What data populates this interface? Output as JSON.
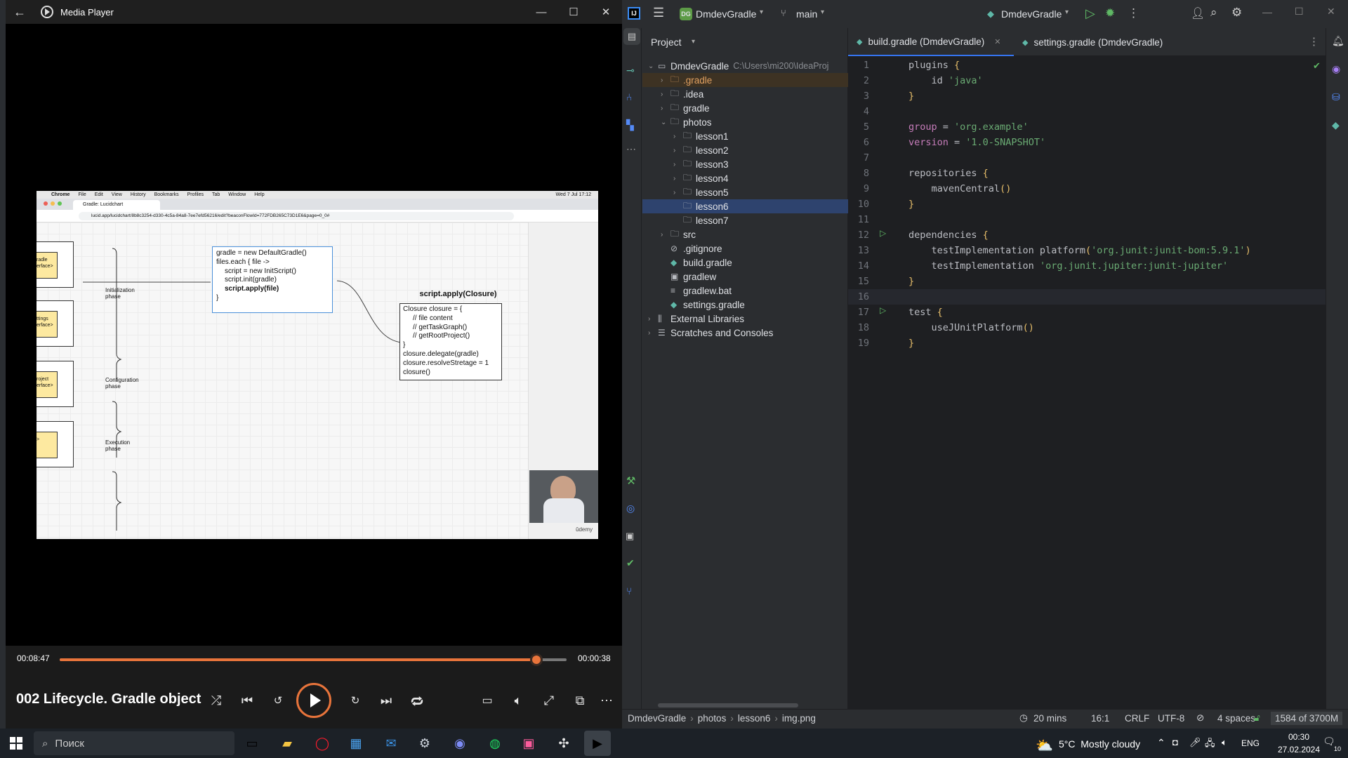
{
  "media_player": {
    "title": "Media Player",
    "video_title": "002 Lifecycle. Gradle object",
    "time_elapsed": "00:08:47",
    "time_remaining": "00:00:38",
    "progress": 0.94,
    "accent_color": "#e8743b",
    "video": {
      "browser_menu": [
        "Chrome",
        "File",
        "Edit",
        "View",
        "History",
        "Bookmarks",
        "Profiles",
        "Tab",
        "Window",
        "Help"
      ],
      "clock": "Wed 7 Jul 17:12",
      "tab_title": "Gradle: Lucidchart",
      "url": "lucid.app/lucidchart/8b8c3254-d330-4c5a-84a8-7ee7efd56216/edit?beaconFlowId=772FDB265C73D1E6&page=0_0#",
      "left_boxes": [
        "radle\nerface>",
        "ttings\nerface>",
        "roject\nerface>",
        ">"
      ],
      "phases": [
        "Initialization\nphase",
        "Configuration\nphase",
        "Execution\nphase"
      ],
      "code_box": [
        "gradle = new DefaultGradle()",
        "files.each { file ->",
        "script = new InitScript()",
        "script.init(gradle)",
        "script.apply(file)",
        "}"
      ],
      "closure_title": "script.apply(Closure)",
      "closure_box": [
        "Closure closure = {",
        "// file content",
        "// getTaskGraph()",
        "// getRootProject()",
        "}",
        "closure.delegate(gradle)",
        "closure.resolveStretage = 1",
        "closure()"
      ],
      "watermark": "ûdemy"
    },
    "controls": [
      "shuffle-icon",
      "previous-icon",
      "rewind-10-icon",
      "play-icon",
      "forward-30-icon",
      "next-icon",
      "repeat-off-icon",
      "captions-icon",
      "volume-icon",
      "fullscreen-icon",
      "miniplayer-icon",
      "more-icon"
    ]
  },
  "ide": {
    "project_name": "DmdevGradle",
    "project_badge": "DG",
    "branch": "main",
    "run_config": "DmdevGradle",
    "panel_title": "Project",
    "tabs": [
      {
        "label": "build.gradle (DmdevGradle)",
        "active": true
      },
      {
        "label": "settings.gradle (DmdevGradle)",
        "active": false
      }
    ],
    "tree": [
      {
        "label": "DmdevGradle",
        "hint": "C:\\Users\\mi200\\IdeaProj",
        "depth": 0,
        "kind": "module",
        "open": true
      },
      {
        "label": ".gradle",
        "depth": 1,
        "kind": "folder-excluded",
        "open": false
      },
      {
        "label": ".idea",
        "depth": 1,
        "kind": "folder",
        "open": false
      },
      {
        "label": "gradle",
        "depth": 1,
        "kind": "folder",
        "open": false
      },
      {
        "label": "photos",
        "depth": 1,
        "kind": "folder",
        "open": true
      },
      {
        "label": "lesson1",
        "depth": 2,
        "kind": "folder",
        "open": false
      },
      {
        "label": "lesson2",
        "depth": 2,
        "kind": "folder",
        "open": false
      },
      {
        "label": "lesson3",
        "depth": 2,
        "kind": "folder",
        "open": false
      },
      {
        "label": "lesson4",
        "depth": 2,
        "kind": "folder",
        "open": false
      },
      {
        "label": "lesson5",
        "depth": 2,
        "kind": "folder",
        "open": false
      },
      {
        "label": "lesson6",
        "depth": 2,
        "kind": "folder",
        "selected": true
      },
      {
        "label": "lesson7",
        "depth": 2,
        "kind": "folder"
      },
      {
        "label": "src",
        "depth": 1,
        "kind": "folder",
        "open": false
      },
      {
        "label": ".gitignore",
        "depth": 1,
        "kind": "gitignore"
      },
      {
        "label": "build.gradle",
        "depth": 1,
        "kind": "gradle"
      },
      {
        "label": "gradlew",
        "depth": 1,
        "kind": "file"
      },
      {
        "label": "gradlew.bat",
        "depth": 1,
        "kind": "text"
      },
      {
        "label": "settings.gradle",
        "depth": 1,
        "kind": "gradle"
      },
      {
        "label": "External Libraries",
        "depth": 0,
        "kind": "lib",
        "open": false
      },
      {
        "label": "Scratches and Consoles",
        "depth": 0,
        "kind": "scratch",
        "open": false
      }
    ],
    "code": [
      "plugins {",
      "    id 'java'",
      "}",
      "",
      "group = 'org.example'",
      "version = '1.0-SNAPSHOT'",
      "",
      "repositories {",
      "    mavenCentral()",
      "}",
      "",
      "dependencies {",
      "    testImplementation platform('org.junit:junit-bom:5.9.1')",
      "    testImplementation 'org.junit.jupiter:junit-jupiter'",
      "}",
      "",
      "test {",
      "    useJUnitPlatform()",
      "}"
    ],
    "breadcrumbs": [
      "DmdevGradle",
      "photos",
      "lesson6",
      "img.png"
    ],
    "status": {
      "time": "20 mins",
      "position": "16:1",
      "line_sep": "CRLF",
      "encoding": "UTF-8",
      "indent": "4 spaces",
      "memory": "1584 of 3700M"
    }
  },
  "taskbar": {
    "search_placeholder": "Поиск",
    "weather": "5°C  Mostly cloudy",
    "lang": "ENG",
    "time": "00:30",
    "date": "27.02.2024",
    "notifications": "10"
  }
}
